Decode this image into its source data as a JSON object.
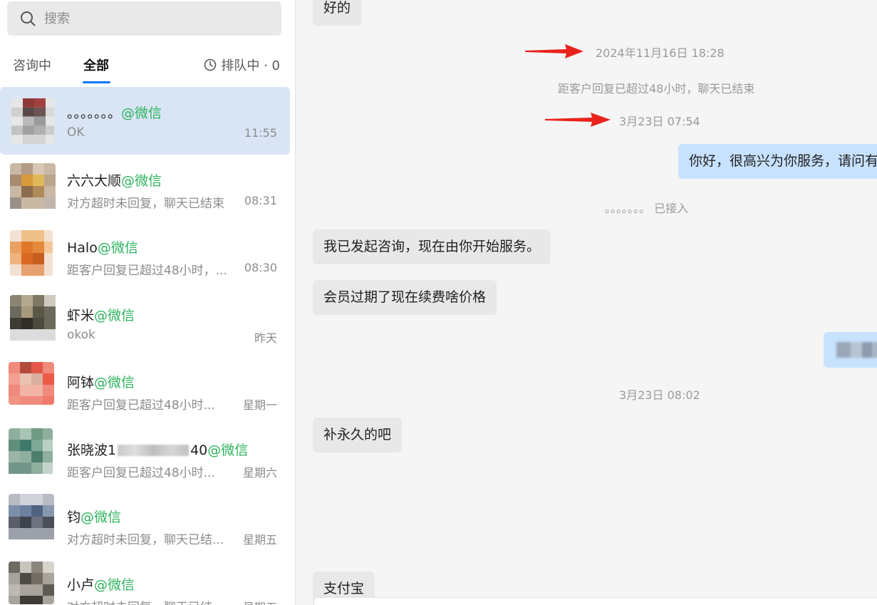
{
  "search": {
    "placeholder": "搜索"
  },
  "tabs": {
    "consulting": "咨询中",
    "all": "全部",
    "queue": "排队中 · 0"
  },
  "conversations": [
    {
      "name": "。。。。。。。",
      "channel": "@微信",
      "preview": "OK",
      "time": "11:55"
    },
    {
      "name": "六六大顺",
      "channel": "@微信",
      "preview": "对方超时未回复，聊天已结束",
      "time": "08:31"
    },
    {
      "name": "Halo",
      "channel": "@微信",
      "preview": "距客户回复已超过48小时，...",
      "time": "08:30"
    },
    {
      "name": "虾米",
      "channel": "@微信",
      "preview": "okok",
      "time": "昨天"
    },
    {
      "name": "阿钵",
      "channel": "@微信",
      "preview": "距客户回复已超过48小时...",
      "time": "星期一"
    },
    {
      "name": "张晓波1",
      "name_tail": "40",
      "channel": "@微信",
      "preview": "距客户回复已超过48小时...",
      "time": "星期六"
    },
    {
      "name": "钧",
      "channel": "@微信",
      "preview": "对方超时未回复，聊天已结...",
      "time": "星期五"
    },
    {
      "name": "小卢",
      "channel": "@微信",
      "preview": "对方超时未回复，聊天已结...",
      "time": "星期五"
    }
  ],
  "chat": {
    "msg_ok": "好的",
    "ts_1": "2024年11月16日 18:28",
    "sys_ended": "距客户回复已超过48小时，聊天已结束",
    "ts_2": "3月23日 07:54",
    "greeting": "你好，很高兴为你服务，请问有",
    "joined_dots": "。。。。。。。",
    "joined_label": "已接入",
    "msg_started": "我已发起咨询，现在由你开始服务。",
    "msg_price": "会员过期了现在续费啥价格",
    "ts_3": "3月23日 08:02",
    "msg_permanent": "补永久的吧",
    "msg_alipay": "支付宝"
  },
  "colors": {
    "accent": "#1677ff",
    "channel": "#2bb35b",
    "selected_bg": "#d9e5f5",
    "out_bubble": "#c7e2ff",
    "arrow": "#e8231c"
  }
}
